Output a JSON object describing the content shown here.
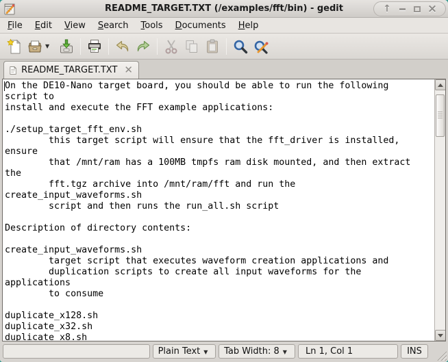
{
  "window": {
    "title": "README_TARGET.TXT (/examples/fft/bin) - gedit",
    "controls": [
      {
        "name": "shade-window",
        "glyph": "↑"
      },
      {
        "name": "minimize-window",
        "glyph": "_"
      },
      {
        "name": "maximize-window",
        "glyph": "□"
      },
      {
        "name": "close-window",
        "glyph": "×"
      }
    ]
  },
  "menu": {
    "items": [
      "File",
      "Edit",
      "View",
      "Search",
      "Tools",
      "Documents",
      "Help"
    ]
  },
  "toolbar": {
    "items": [
      "new-document",
      "open-document",
      "open-dropdown",
      "save-document",
      "print-document",
      "undo",
      "redo",
      "cut",
      "copy",
      "paste",
      "find",
      "find-and-replace"
    ],
    "disabled_items": [
      "cut",
      "copy",
      "paste"
    ],
    "dropdown_glyph": "▼"
  },
  "tab": {
    "label": "README_TARGET.TXT",
    "close_glyph": "✕"
  },
  "editor": {
    "lines": [
      "On the DE10-Nano target board, you should be able to run the following",
      "script to",
      "install and execute the FFT example applications:",
      "",
      "./setup_target_fft_env.sh",
      "        this target script will ensure that the fft_driver is installed,",
      "ensure",
      "        that /mnt/ram has a 100MB tmpfs ram disk mounted, and then extract",
      "the",
      "        fft.tgz archive into /mnt/ram/fft and run the",
      "create_input_waveforms.sh",
      "        script and then runs the run_all.sh script",
      "",
      "Description of directory contents:",
      "",
      "create_input_waveforms.sh",
      "        target script that executes waveform creation applications and",
      "        duplication scripts to create all input waveforms for the",
      "applications",
      "        to consume",
      "",
      "duplicate_x128.sh",
      "duplicate_x32.sh",
      "duplicate_x8.sh"
    ]
  },
  "statusbar": {
    "message": "",
    "language": "Plain Text",
    "tab_width": "Tab Width: 8",
    "cursor_position": "Ln 1, Col 1",
    "mode": "INS",
    "dropdown_glyph": "▼"
  },
  "colors": {
    "desktop": "#2f9a8f",
    "window_chrome": "#d7d4d0",
    "editor_background": "#ffffff",
    "editor_text": "#000000"
  }
}
